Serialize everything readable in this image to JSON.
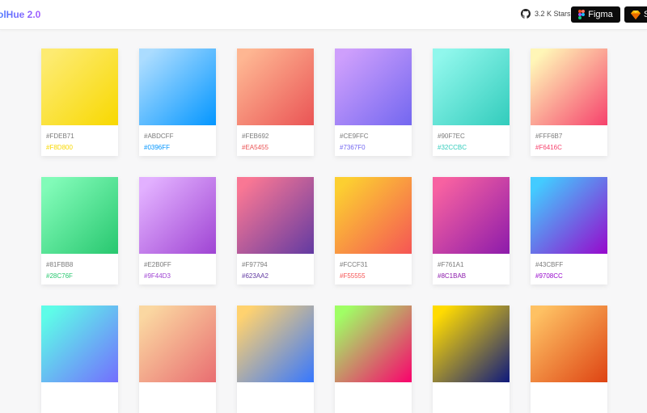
{
  "app": {
    "title": "olHue 2.0"
  },
  "header": {
    "stars_label": "3.2 K Stars",
    "figma_label": "Figma",
    "sketch_label": "S"
  },
  "cards": [
    {
      "c1": "#FDEB71",
      "c2": "#F8D800"
    },
    {
      "c1": "#ABDCFF",
      "c2": "#0396FF"
    },
    {
      "c1": "#FEB692",
      "c2": "#EA5455"
    },
    {
      "c1": "#CE9FFC",
      "c2": "#7367F0"
    },
    {
      "c1": "#90F7EC",
      "c2": "#32CCBC"
    },
    {
      "c1": "#FFF6B7",
      "c2": "#F6416C"
    },
    {
      "c1": "#81FBB8",
      "c2": "#28C76F"
    },
    {
      "c1": "#E2B0FF",
      "c2": "#9F44D3"
    },
    {
      "c1": "#F97794",
      "c2": "#623AA2"
    },
    {
      "c1": "#FCCF31",
      "c2": "#F55555"
    },
    {
      "c1": "#F761A1",
      "c2": "#8C1BAB"
    },
    {
      "c1": "#43CBFF",
      "c2": "#9708CC"
    },
    {
      "c1": "#5EFCE8",
      "c2": "#736EFE"
    },
    {
      "c1": "#FAD7A1",
      "c2": "#E96D71"
    },
    {
      "c1": "#FFD26F",
      "c2": "#3677FF"
    },
    {
      "c1": "#A0FE65",
      "c2": "#FA016D"
    },
    {
      "c1": "#FFDB01",
      "c2": "#0E197D"
    },
    {
      "c1": "#FEC163",
      "c2": "#DE4313"
    }
  ]
}
